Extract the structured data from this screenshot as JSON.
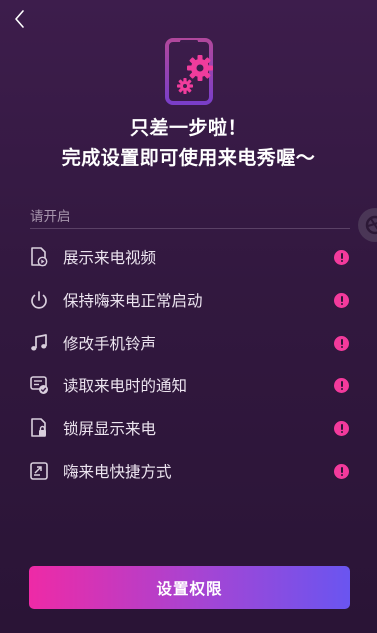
{
  "headline": {
    "line1": "只差一步啦！",
    "line2": "完成设置即可使用来电秀喔～"
  },
  "section_label": "请开启",
  "permissions": [
    {
      "label": "展示来电视频",
      "icon": "video-file-icon"
    },
    {
      "label": "保持嗨来电正常启动",
      "icon": "power-icon"
    },
    {
      "label": "修改手机铃声",
      "icon": "music-note-icon"
    },
    {
      "label": "读取来电时的通知",
      "icon": "notification-check-icon"
    },
    {
      "label": "锁屏显示来电",
      "icon": "lock-screen-icon"
    },
    {
      "label": "嗨来电快捷方式",
      "icon": "shortcut-icon"
    }
  ],
  "cta_label": "设置权限",
  "colors": {
    "background": "#341a42",
    "warning": "#f33a9c",
    "button_gradient_start": "#ee2aa6",
    "button_gradient_end": "#6a55f0"
  }
}
